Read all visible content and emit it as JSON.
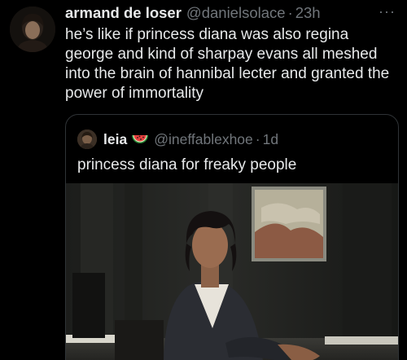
{
  "tweet": {
    "author_name": "armand de loser",
    "author_handle": "@danielsolace",
    "time": "23h",
    "dot": "·",
    "more": "···",
    "text": "he’s like if princess diana was also regina george and kind of sharpay evans all meshed into the brain of hannibal lecter and granted the power of immortality"
  },
  "quote": {
    "author_name": "leia",
    "emoji": "watermelon-icon",
    "author_handle": "@ineffablexhoe",
    "dot": "·",
    "time": "1d",
    "text": "princess diana for freaky people"
  },
  "colors": {
    "background": "#000000",
    "text": "#e7e9ea",
    "secondary": "#71767b",
    "border": "#2f3336"
  }
}
